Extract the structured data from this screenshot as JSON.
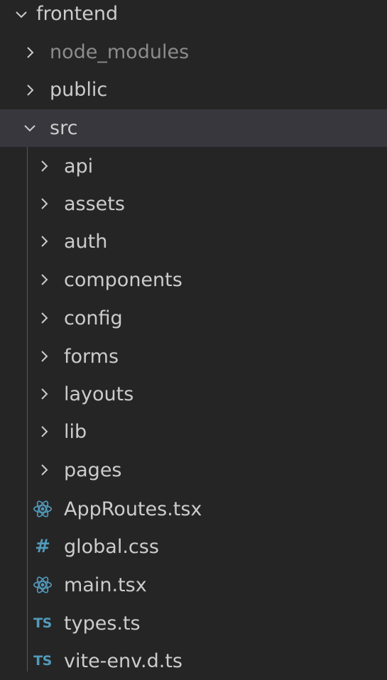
{
  "explorer": {
    "items": [
      {
        "label": "frontend",
        "kind": "folder",
        "expanded": true,
        "depth": 0
      },
      {
        "label": "node_modules",
        "kind": "folder",
        "expanded": false,
        "depth": 1,
        "dimmed": true
      },
      {
        "label": "public",
        "kind": "folder",
        "expanded": false,
        "depth": 1
      },
      {
        "label": "src",
        "kind": "folder",
        "expanded": true,
        "depth": 1,
        "selected": true
      },
      {
        "label": "api",
        "kind": "folder",
        "expanded": false,
        "depth": 2
      },
      {
        "label": "assets",
        "kind": "folder",
        "expanded": false,
        "depth": 2
      },
      {
        "label": "auth",
        "kind": "folder",
        "expanded": false,
        "depth": 2
      },
      {
        "label": "components",
        "kind": "folder",
        "expanded": false,
        "depth": 2
      },
      {
        "label": "config",
        "kind": "folder",
        "expanded": false,
        "depth": 2
      },
      {
        "label": "forms",
        "kind": "folder",
        "expanded": false,
        "depth": 2
      },
      {
        "label": "layouts",
        "kind": "folder",
        "expanded": false,
        "depth": 2
      },
      {
        "label": "lib",
        "kind": "folder",
        "expanded": false,
        "depth": 2
      },
      {
        "label": "pages",
        "kind": "folder",
        "expanded": false,
        "depth": 2
      },
      {
        "label": "AppRoutes.tsx",
        "kind": "file",
        "icon": "react-icon",
        "depth": 2
      },
      {
        "label": "global.css",
        "kind": "file",
        "icon": "css-hash-icon",
        "icon_text": "#",
        "depth": 2
      },
      {
        "label": "main.tsx",
        "kind": "file",
        "icon": "react-icon",
        "depth": 2
      },
      {
        "label": "types.ts",
        "kind": "file",
        "icon": "typescript-icon",
        "icon_text": "TS",
        "depth": 2
      },
      {
        "label": "vite-env.d.ts",
        "kind": "file",
        "icon": "typescript-icon",
        "icon_text": "TS",
        "depth": 2
      }
    ]
  },
  "colors": {
    "background": "#252526",
    "selected_row": "#37373d",
    "text": "#cccccc",
    "dimmed_text": "#8c8c8c",
    "file_icon": "#519aba"
  }
}
